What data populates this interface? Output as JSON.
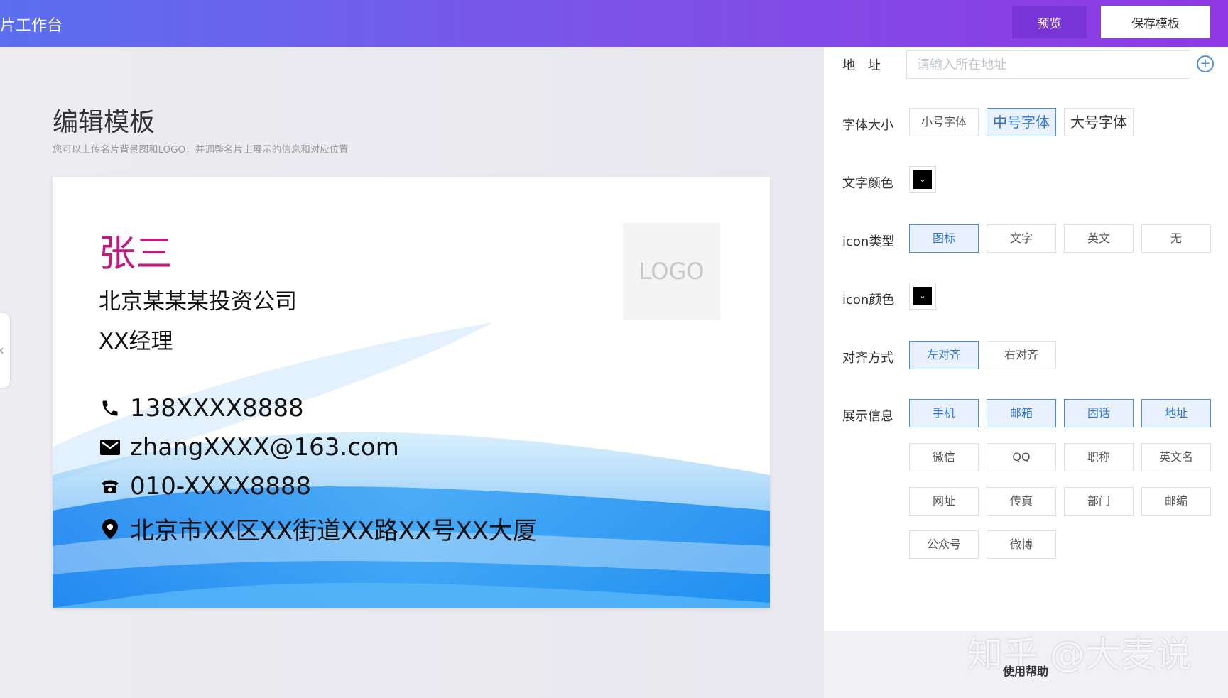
{
  "header": {
    "title": "片工作台",
    "preview_label": "预览",
    "save_label": "保存模板"
  },
  "editor": {
    "title": "编辑模板",
    "subtitle": "您可以上传名片背景图和LOGO，并调整名片上展示的信息和对应位置"
  },
  "card": {
    "name": "张三",
    "company": "北京某某某投资公司",
    "job_title": "XX经理",
    "logo_text": "LOGO",
    "contacts": [
      {
        "icon": "phone-icon",
        "text": "138XXXX8888"
      },
      {
        "icon": "email-icon",
        "text": "zhangXXXX@163.com"
      },
      {
        "icon": "landline-icon",
        "text": "010-XXXX8888"
      },
      {
        "icon": "location-icon",
        "text": "北京市XX区XX街道XX路XX号XX大厦"
      }
    ],
    "colors": {
      "name": "#c1197f",
      "text": "#111111"
    }
  },
  "panel": {
    "address": {
      "label": "地　址",
      "placeholder": "请输入所在地址",
      "value": ""
    },
    "font_size": {
      "label": "字体大小",
      "options": [
        "小号字体",
        "中号字体",
        "大号字体"
      ],
      "selected": "中号字体"
    },
    "text_color": {
      "label": "文字颜色",
      "value": "#000000"
    },
    "icon_type": {
      "label": "icon类型",
      "options": [
        "图标",
        "文字",
        "英文",
        "无"
      ],
      "selected": "图标"
    },
    "icon_color": {
      "label": "icon颜色",
      "value": "#000000"
    },
    "align": {
      "label": "对齐方式",
      "options": [
        "左对齐",
        "右对齐"
      ],
      "selected": "左对齐"
    },
    "display_info": {
      "label": "展示信息",
      "options": [
        "手机",
        "邮箱",
        "固话",
        "地址",
        "微信",
        "QQ",
        "职称",
        "英文名",
        "网址",
        "传真",
        "部门",
        "邮编",
        "公众号",
        "微博"
      ],
      "selected": [
        "手机",
        "邮箱",
        "固话",
        "地址"
      ]
    },
    "help_label": "使用帮助"
  },
  "watermark": "知乎 @大麦说",
  "theme": {
    "accent": "#4a90e2",
    "header_start": "#5b6ff0",
    "header_end": "#9038e4"
  }
}
